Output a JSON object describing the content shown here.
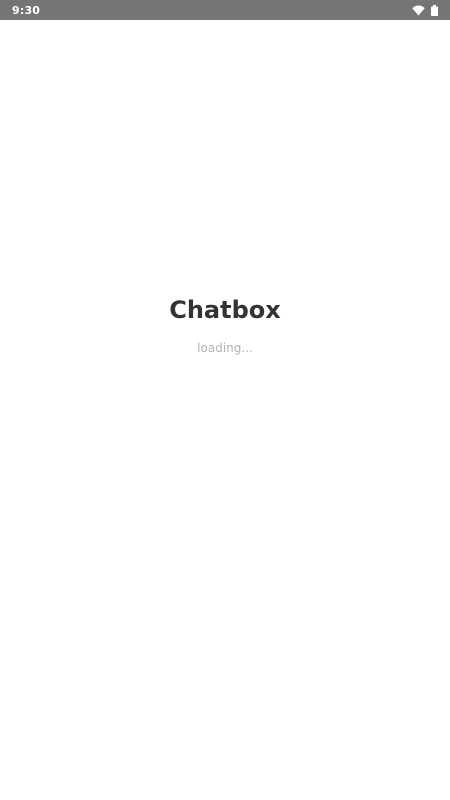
{
  "status_bar": {
    "time": "9:30",
    "icons": [
      "wifi-icon",
      "battery-icon"
    ],
    "background_color": "#757575"
  },
  "splash": {
    "title": "Chatbox",
    "loading_text": "loading..."
  },
  "colors": {
    "title": "#333333",
    "loading": "#b3b3b3",
    "background": "#ffffff"
  }
}
